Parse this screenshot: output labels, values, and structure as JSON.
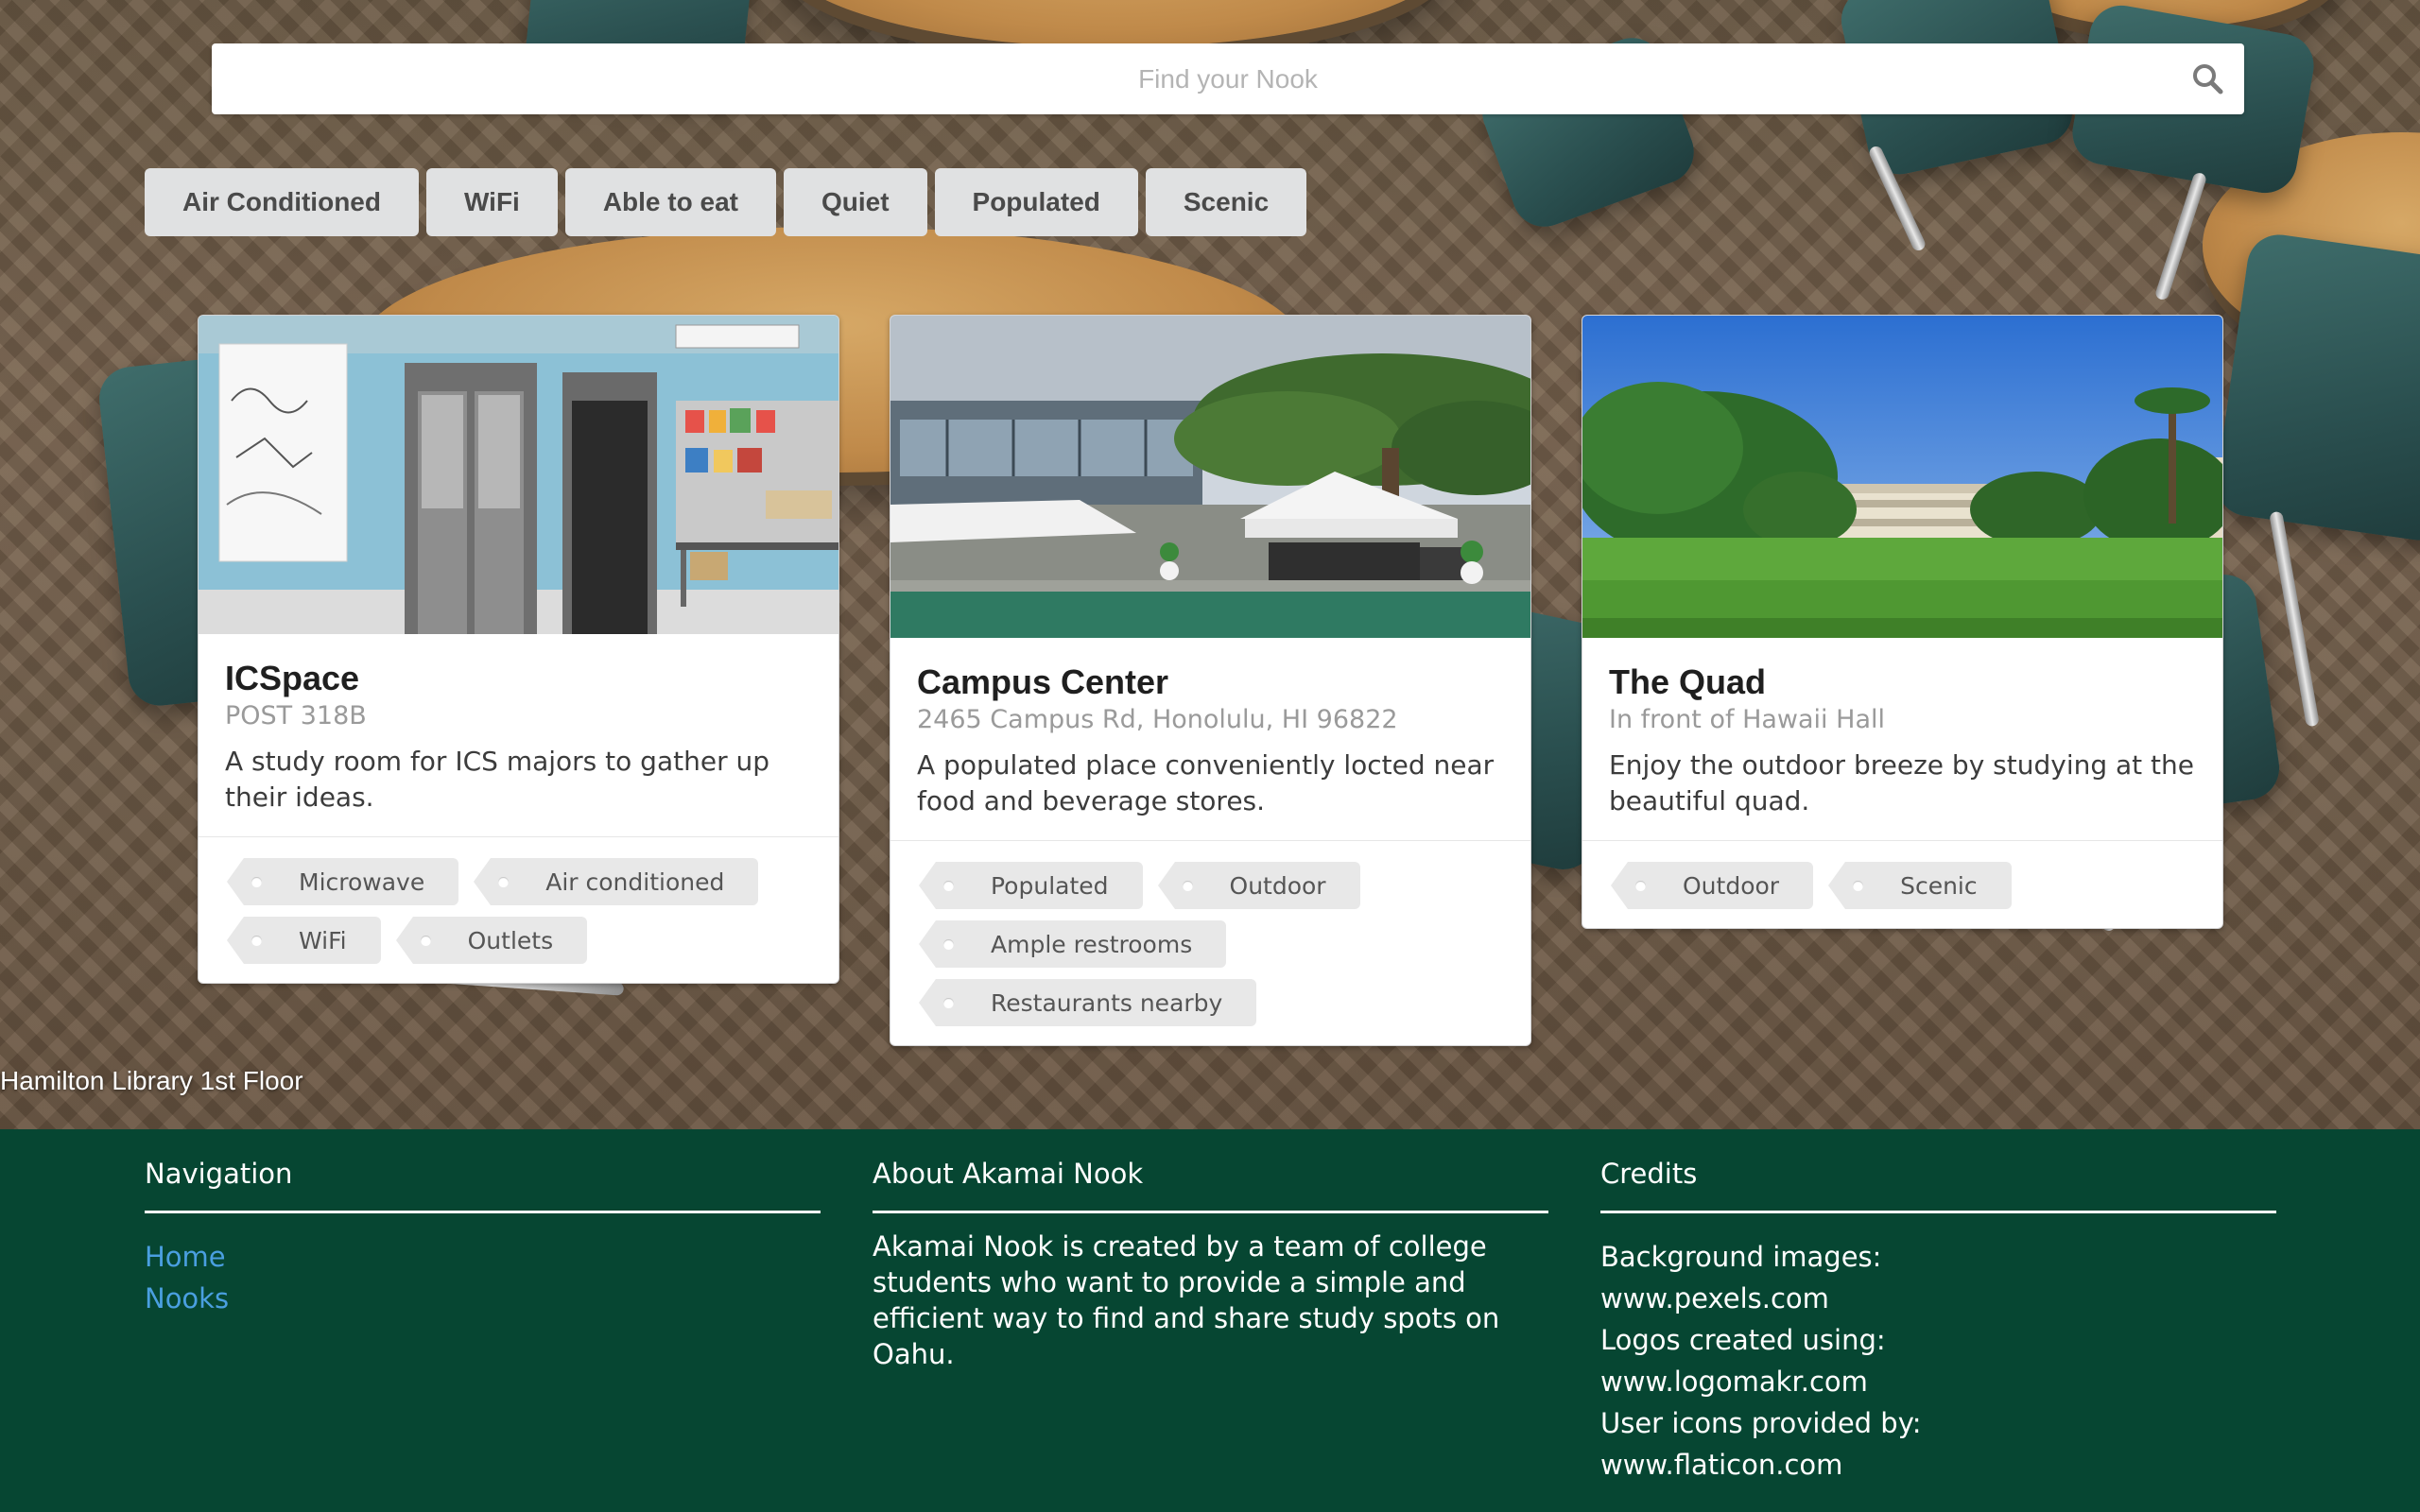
{
  "search": {
    "placeholder": "Find your Nook",
    "icon": "search-icon"
  },
  "filters": [
    "Air Conditioned",
    "WiFi",
    "Able to eat",
    "Quiet",
    "Populated",
    "Scenic"
  ],
  "cards": [
    {
      "title": "ICSpace",
      "meta": "POST 318B",
      "description": "A study room for ICS majors to gather up their ideas.",
      "tags": [
        "Microwave",
        "Air conditioned",
        "WiFi",
        "Outlets"
      ]
    },
    {
      "title": "Campus Center",
      "meta": "2465 Campus Rd, Honolulu, HI 96822",
      "description": "A populated place conveniently locted near food and beverage stores.",
      "tags": [
        "Populated",
        "Outdoor",
        "Ample restrooms",
        "Restaurants nearby"
      ]
    },
    {
      "title": "The Quad",
      "meta": "In front of Hawaii Hall",
      "description": "Enjoy the outdoor breeze by studying at the beautiful quad.",
      "tags": [
        "Outdoor",
        "Scenic"
      ]
    }
  ],
  "background_caption": "Hamilton Library 1st Floor",
  "footer": {
    "navigation": {
      "heading": "Navigation",
      "links": [
        "Home",
        "Nooks"
      ]
    },
    "about": {
      "heading": "About Akamai Nook",
      "text": "Akamai Nook is created by a team of college students who want to provide a simple and efficient way to find and share study spots on Oahu."
    },
    "credits": {
      "heading": "Credits",
      "lines": [
        "Background images:",
        "www.pexels.com",
        "Logos created using:",
        "www.logomakr.com",
        "User icons provided by:",
        "www.flaticon.com"
      ]
    }
  },
  "colors": {
    "footer_bg": "#064632",
    "link": "#4a9fe0",
    "filter_bg": "#e0e1e2",
    "tag_bg": "#e8e8e8"
  }
}
